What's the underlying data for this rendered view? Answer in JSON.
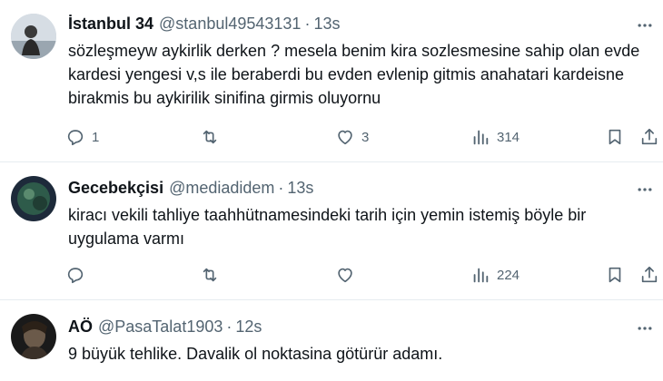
{
  "tweets": [
    {
      "name": "İstanbul 34",
      "handle": "@stanbul49543131",
      "separator": "·",
      "time": "13s",
      "text": "sözleşmeyw aykirlik derken ? mesela benim kira sozlesmesine sahip olan evde kardesi yengesi v,s ile beraberdi bu evden evlenip gitmis anahatari kardeisne birakmis bu aykirilik  sinifina girmis oluyornu",
      "reply_count": "1",
      "retweet_count": "",
      "like_count": "3",
      "view_count": "314"
    },
    {
      "name": "Gecebekçisi",
      "handle": "@mediadidem",
      "separator": "·",
      "time": "13s",
      "text": "kiracı vekili tahliye taahhütnamesindeki tarih için yemin istemiş böyle bir uygulama varmı",
      "reply_count": "",
      "retweet_count": "",
      "like_count": "",
      "view_count": "224"
    },
    {
      "name": "AÖ",
      "handle": "@PasaTalat1903",
      "separator": "·",
      "time": "12s",
      "text": "9 büyük tehlike. Davalik ol noktasina götürür adamı."
    }
  ],
  "icons": {
    "reply": "reply-icon",
    "retweet": "retweet-icon",
    "like": "heart-icon",
    "views": "views-icon",
    "bookmark": "bookmark-icon",
    "share": "share-icon",
    "more": "more-icon"
  },
  "colors": {
    "text": "#0f1419",
    "secondary": "#536471",
    "divider": "#e6ecf0"
  }
}
